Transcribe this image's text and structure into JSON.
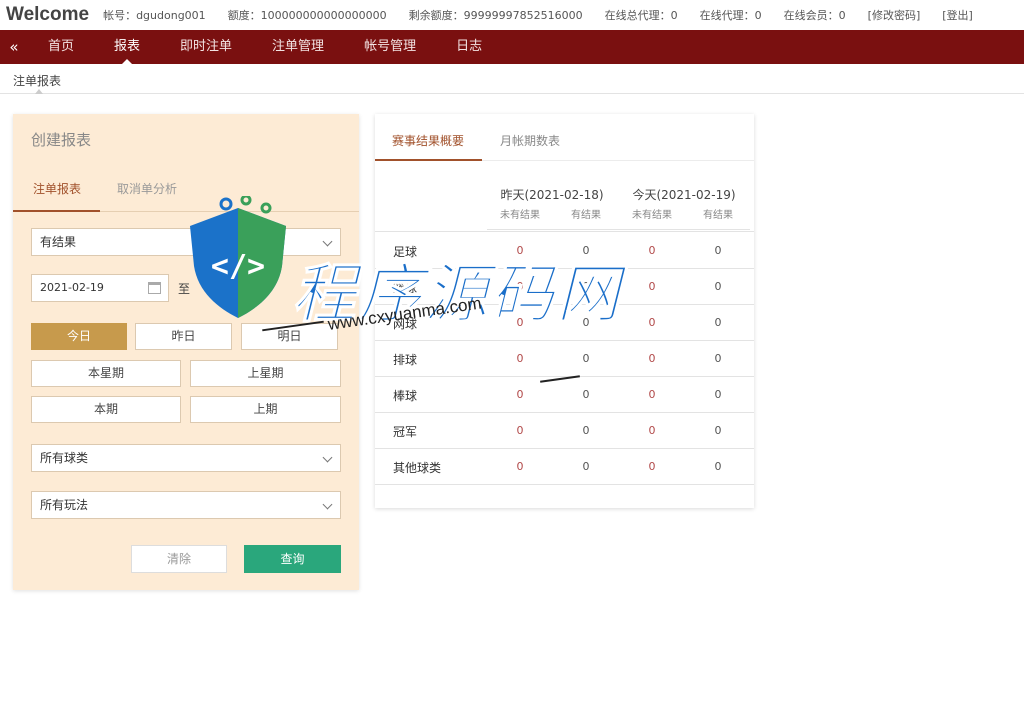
{
  "topbar": {
    "welcome": "Welcome",
    "account": "帐号：dgudong001",
    "quota": "额度：100000000000000000",
    "remaining": "剩余额度：99999997852516000",
    "online_general_agents": "在线总代理：0",
    "online_agents": "在线代理：0",
    "online_members": "在线会员：0",
    "change_password": "[修改密码]",
    "logout": "[登出]"
  },
  "nav": {
    "collapse": "«",
    "items": [
      "首页",
      "报表",
      "即时注单",
      "注单管理",
      "帐号管理",
      "日志"
    ]
  },
  "breadcrumb": "注单报表",
  "panel": {
    "title": "创建报表",
    "tabs": [
      "注单报表",
      "取消单分析"
    ],
    "result_select": "有结果",
    "date_from": "2021-02-19",
    "to_label": "至",
    "quick_buttons": [
      "今日",
      "昨日",
      "明日",
      "本星期",
      "上星期",
      "本期",
      "上期"
    ],
    "sport_select": "所有球类",
    "play_select": "所有玩法",
    "clear_label": "清除",
    "query_label": "查询"
  },
  "summary": {
    "tabs": [
      "赛事结果概要",
      "月帐期数表"
    ],
    "yesterday": "昨天(2021-02-18)",
    "today": "今天(2021-02-19)",
    "subheaders": [
      "未有结果",
      "有结果",
      "未有结果",
      "有结果"
    ],
    "rows": [
      {
        "sport": "足球",
        "values": [
          "0",
          "0",
          "0",
          "0"
        ]
      },
      {
        "sport": "篮球",
        "values": [
          "0",
          "0",
          "0",
          "0"
        ]
      },
      {
        "sport": "网球",
        "values": [
          "0",
          "0",
          "0",
          "0"
        ]
      },
      {
        "sport": "排球",
        "values": [
          "0",
          "0",
          "0",
          "0"
        ]
      },
      {
        "sport": "棒球",
        "values": [
          "0",
          "0",
          "0",
          "0"
        ]
      },
      {
        "sport": "冠军",
        "values": [
          "0",
          "0",
          "0",
          "0"
        ]
      },
      {
        "sport": "其他球类",
        "values": [
          "0",
          "0",
          "0",
          "0"
        ]
      }
    ]
  },
  "watermark": {
    "text": "程序源码网",
    "url": "www.cxyuanma.com"
  },
  "colors": {
    "nav_bg": "#7a1010",
    "accent": "#a1512b",
    "active_button": "#c79a4c",
    "query_button": "#2aa77c",
    "panel_bg": "#fdebd5"
  }
}
